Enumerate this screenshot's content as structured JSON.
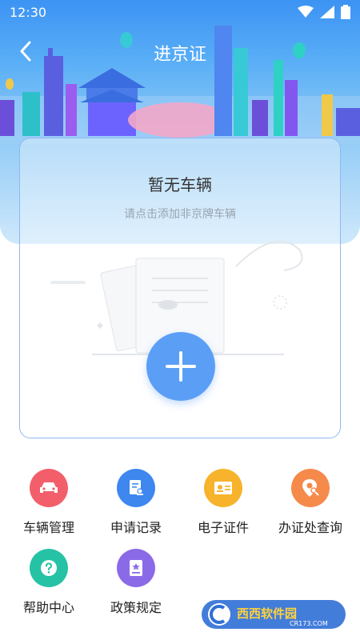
{
  "status_bar": {
    "time": "12:30",
    "icons": [
      "wifi-icon",
      "signal-icon",
      "battery-icon"
    ]
  },
  "header": {
    "title": "进京证",
    "back_icon": "chevron-left-icon"
  },
  "card": {
    "title": "暂无车辆",
    "hint": "请点击添加非京牌车辆",
    "add_icon": "plus-icon"
  },
  "menu": [
    {
      "label": "车辆管理",
      "icon": "car-icon",
      "color": "#f25f6b"
    },
    {
      "label": "申请记录",
      "icon": "document-stamp-icon",
      "color": "#3d87ef"
    },
    {
      "label": "电子证件",
      "icon": "id-card-icon",
      "color": "#f7b32b"
    },
    {
      "label": "办证处查询",
      "icon": "location-search-icon",
      "color": "#f58a4b"
    },
    {
      "label": "帮助中心",
      "icon": "question-icon",
      "color": "#25c2a5"
    },
    {
      "label": "政策规定",
      "icon": "policy-book-icon",
      "color": "#8b6ae8"
    }
  ],
  "watermark": {
    "brand": "西西软件园",
    "site": "CR173.COM"
  },
  "colors": {
    "accent": "#5b9ef6",
    "banner_top": "#3c93f3",
    "card_border": "#8fb8ef"
  }
}
